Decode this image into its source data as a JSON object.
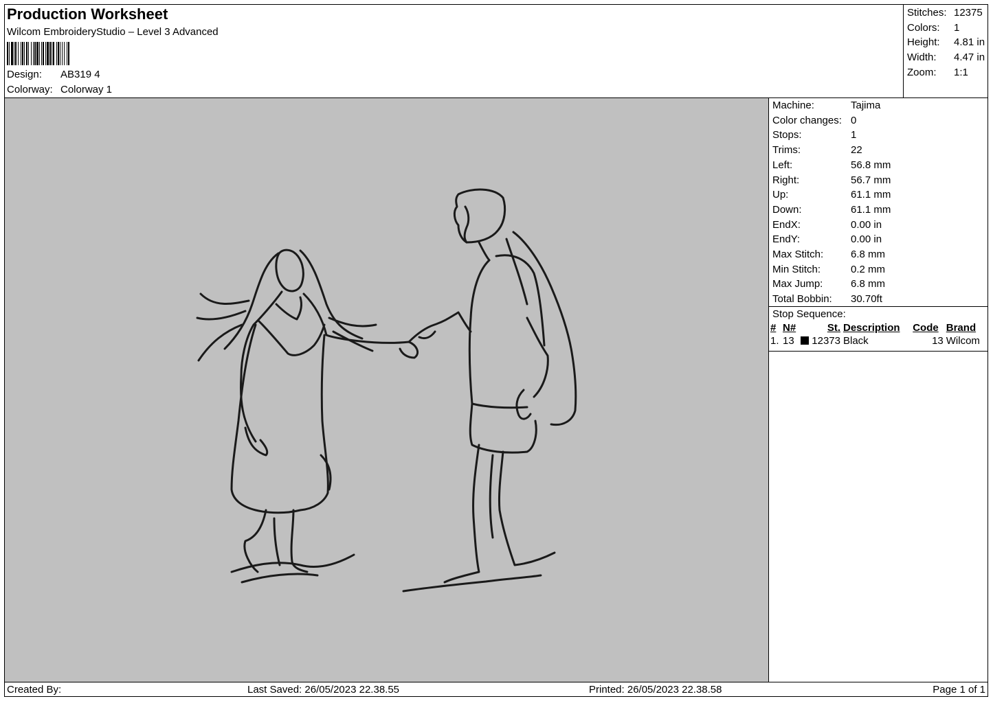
{
  "header": {
    "title": "Production Worksheet",
    "software": "Wilcom EmbroideryStudio – Level 3 Advanced",
    "design_label": "Design:",
    "design_value": "AB319 4",
    "colorway_label": "Colorway:",
    "colorway_value": "Colorway 1"
  },
  "stats": [
    {
      "label": "Stitches:",
      "value": "12375"
    },
    {
      "label": "Colors:",
      "value": "1"
    },
    {
      "label": "Height:",
      "value": "4.81 in"
    },
    {
      "label": "Width:",
      "value": "4.47 in"
    },
    {
      "label": "Zoom:",
      "value": "1:1"
    }
  ],
  "machine_info": [
    {
      "label": "Machine:",
      "value": "Tajima"
    },
    {
      "label": "Color changes:",
      "value": "0"
    },
    {
      "label": "Stops:",
      "value": "1"
    },
    {
      "label": "Trims:",
      "value": "22"
    },
    {
      "label": "Left:",
      "value": "56.8 mm"
    },
    {
      "label": "Right:",
      "value": "56.7 mm"
    },
    {
      "label": "Up:",
      "value": "61.1 mm"
    },
    {
      "label": "Down:",
      "value": "61.1 mm"
    },
    {
      "label": "EndX:",
      "value": "0.00 in"
    },
    {
      "label": "EndY:",
      "value": "0.00 in"
    },
    {
      "label": "Max Stitch:",
      "value": "6.8 mm"
    },
    {
      "label": "Min Stitch:",
      "value": "0.2 mm"
    },
    {
      "label": "Max Jump:",
      "value": "6.8 mm"
    },
    {
      "label": "Total Bobbin:",
      "value": "30.70ft"
    }
  ],
  "stop_sequence": {
    "label": "Stop Sequence:",
    "columns": [
      "#",
      "N#",
      "St.",
      "Description",
      "Code",
      "Brand"
    ],
    "rows": [
      {
        "index": "1.",
        "needle": "13",
        "swatch_color": "#000000",
        "stitches": "12373",
        "description": "Black",
        "code": "13",
        "brand": "Wilcom"
      }
    ]
  },
  "footer": {
    "created_by": "Created By:",
    "last_saved": "Last Saved: 26/05/2023 22.38.55",
    "printed": "Printed: 26/05/2023 22.38.58",
    "page": "Page 1 of 1"
  },
  "colors": {
    "canvas_bg": "#c0c0c0",
    "stitch": "#1a1a1a"
  }
}
